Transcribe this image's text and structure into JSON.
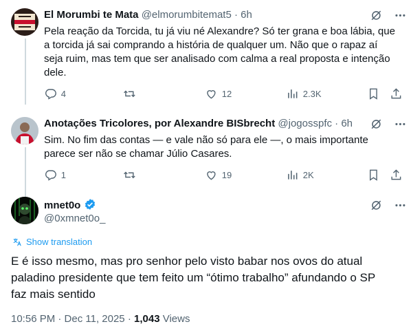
{
  "tweets": [
    {
      "name": "El Morumbi te Mata",
      "handle": "@elmorumbitemat5",
      "time": "· 6h",
      "avatar_text": "El Morumbi\nTE MATA",
      "lines": [
        "Pela reação da Torcida, tu já viu né Alexandre? Só ter grana e boa lábia, que",
        "a torcida já sai comprando a história de qualquer um. Não que o rapaz aí",
        "seja ruim, mas tem que ser analisado com calma a real proposta e intenção",
        "dele."
      ],
      "replies": "4",
      "retweets": "",
      "likes": "12",
      "views": "2.3K"
    },
    {
      "name": "Anotações Tricolores, por Alexandre BISbrecht",
      "handle": "@jogosspfc",
      "time": "· 6h",
      "lines": [
        "Sim. No fim das contas — e vale não só para ele —, o mais importante",
        "parece ser não se chamar Júlio Casares."
      ],
      "replies": "1",
      "retweets": "",
      "likes": "19",
      "views": "2K"
    }
  ],
  "main": {
    "name": "mnet0o",
    "handle": "@0xmnet0o_",
    "show_translation": "Show translation",
    "lines": [
      "E é isso mesmo, mas pro senhor pelo visto babar nos ovos do atual",
      "paladino presidente que tem feito um “ótimo trabalho” afundando o SP",
      "faz mais sentido"
    ],
    "time": "10:56 PM · Dec 11, 2025 ·",
    "views_count": "1,043",
    "views_label": "Views"
  },
  "colors": {
    "accent": "#1d9bf0",
    "muted": "#536471",
    "text": "#0f1419"
  }
}
